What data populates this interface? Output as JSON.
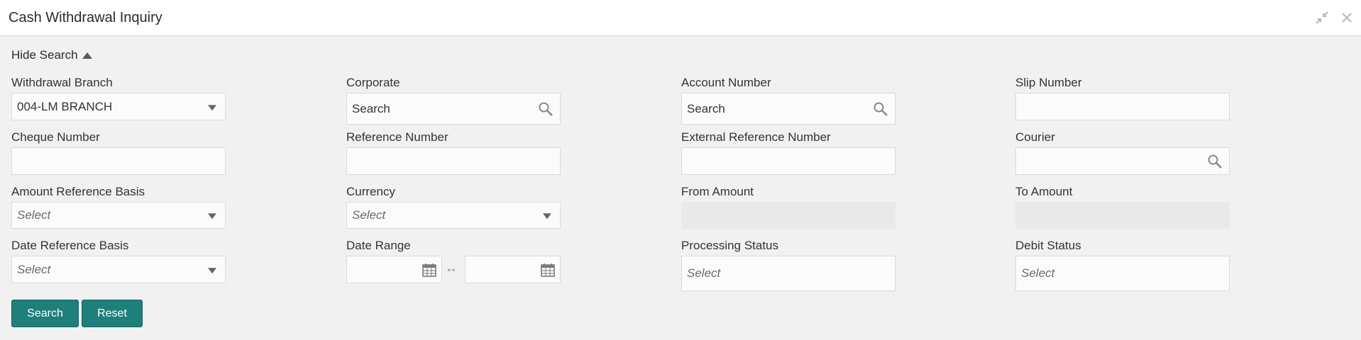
{
  "window": {
    "title": "Cash Withdrawal Inquiry",
    "icons": [
      "minimize-icon",
      "close-icon"
    ]
  },
  "search_toggle": {
    "label": "Hide Search"
  },
  "fields": {
    "withdrawal_branch": {
      "label": "Withdrawal Branch",
      "value": "004-LM BRANCH"
    },
    "corporate": {
      "label": "Corporate",
      "placeholder": "Search"
    },
    "account_number": {
      "label": "Account Number",
      "placeholder": "Search"
    },
    "slip_number": {
      "label": "Slip Number",
      "value": ""
    },
    "cheque_number": {
      "label": "Cheque Number",
      "value": ""
    },
    "reference_number": {
      "label": "Reference Number",
      "value": ""
    },
    "external_reference_number": {
      "label": "External Reference Number",
      "value": ""
    },
    "courier": {
      "label": "Courier",
      "value": ""
    },
    "amount_reference_basis": {
      "label": "Amount Reference Basis",
      "placeholder": "Select"
    },
    "currency": {
      "label": "Currency",
      "placeholder": "Select"
    },
    "from_amount": {
      "label": "From Amount",
      "value": ""
    },
    "to_amount": {
      "label": "To Amount",
      "value": ""
    },
    "date_reference_basis": {
      "label": "Date Reference Basis",
      "placeholder": "Select"
    },
    "date_range": {
      "label": "Date Range",
      "from": "",
      "to": "",
      "separator": "↔"
    },
    "processing_status": {
      "label": "Processing Status",
      "placeholder": "Select"
    },
    "debit_status": {
      "label": "Debit Status",
      "placeholder": "Select"
    }
  },
  "buttons": {
    "search": "Search",
    "reset": "Reset"
  },
  "colors": {
    "button": "#1f7f7b",
    "background": "#f1f1f1",
    "header": "#ffffff"
  }
}
